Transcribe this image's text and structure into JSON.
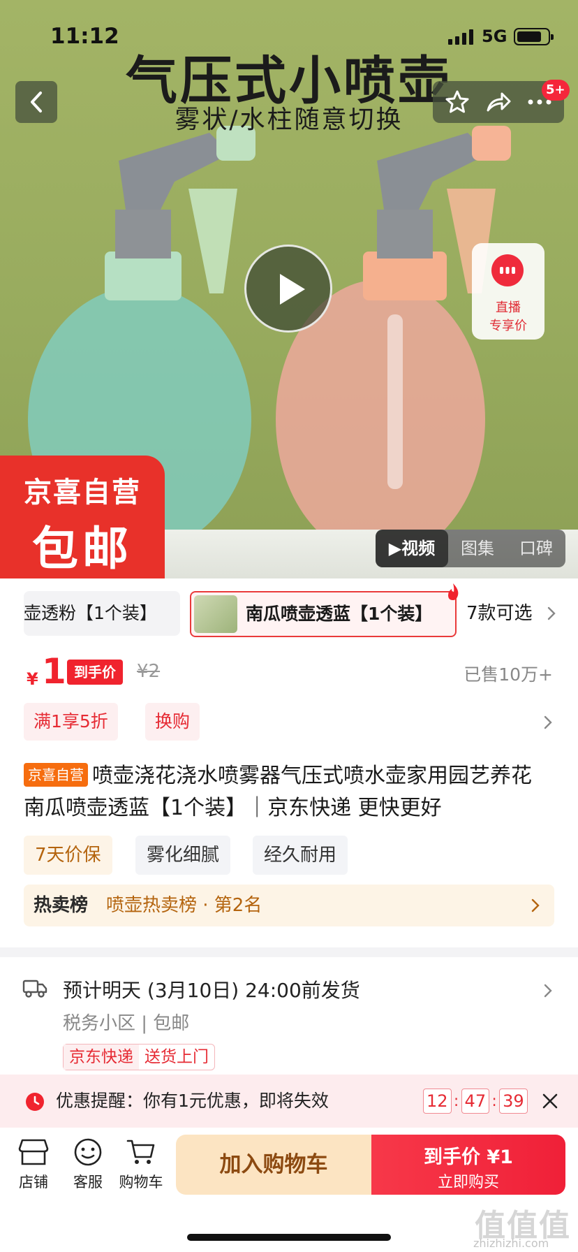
{
  "status": {
    "time": "11:12",
    "network": "5G"
  },
  "hero": {
    "title": "气压式小喷壶",
    "subtitle": "雾状/水柱随意切换",
    "badge_count": "5+",
    "live_line1": "直播",
    "live_line2": "专享价",
    "promo_top": "京喜自营",
    "promo_bottom": "包邮",
    "media_tabs": [
      "▶视频",
      "图集",
      "口碑"
    ]
  },
  "variants": {
    "item_a": "壶透粉【1个装】",
    "item_b": "南瓜喷壶透蓝【1个装】",
    "more": "7款可选"
  },
  "price": {
    "symbol": "¥",
    "value": "1",
    "tag": "到手价",
    "original": "¥2",
    "sold": "已售10万+"
  },
  "promos": [
    "满1享5折",
    "换购"
  ],
  "product": {
    "self_tag": "京喜自营",
    "title": "喷壶浇花浇水喷雾器气压式喷水壶家用园艺养花 南瓜喷壶透蓝【1个装】｜京东快递 更快更好"
  },
  "features": [
    "7天价保",
    "雾化细腻",
    "经久耐用"
  ],
  "rank": {
    "label": "热卖榜",
    "text": "喷壶热卖榜 · 第2名"
  },
  "shipping": {
    "main": "预计明天 (3月10日) 24:00前发货",
    "location": "税务小区 | 包邮",
    "tag_a": "京东快递",
    "tag_b": "送货上门"
  },
  "reminder": {
    "text": "优惠提醒：你有1元优惠，即将失效",
    "h": "12",
    "m": "47",
    "s": "39"
  },
  "bottom": {
    "shop": "店铺",
    "service": "客服",
    "cart": "购物车",
    "add_cart": "加入购物车",
    "buy_top": "到手价 ¥1",
    "buy_bottom": "立即购买"
  },
  "watermark": {
    "main": "值值值",
    "sub": "zhizhizhi.com"
  },
  "colors": {
    "accent": "#f0232e",
    "hero_bg": "#9aad60",
    "promo_red": "#e8312a",
    "orange": "#f66d0f"
  }
}
